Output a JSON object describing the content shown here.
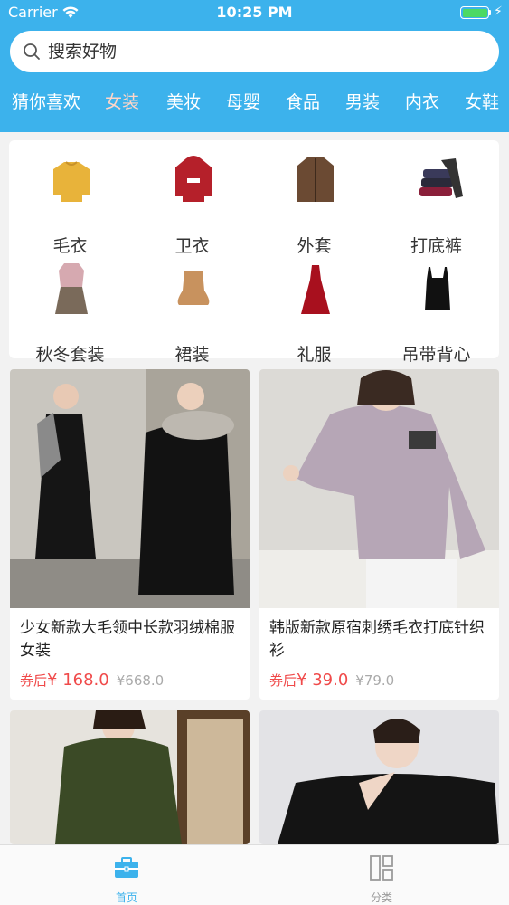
{
  "status": {
    "carrier": "Carrier",
    "time": "10:25 PM"
  },
  "search": {
    "placeholder": "搜索好物"
  },
  "categories": [
    "猜你喜欢",
    "女装",
    "美妆",
    "母婴",
    "食品",
    "男装",
    "内衣",
    "女鞋"
  ],
  "active_category": "女装",
  "subcategories": [
    {
      "label": "毛衣",
      "icon": "sweater-icon"
    },
    {
      "label": "卫衣",
      "icon": "hoodie-icon"
    },
    {
      "label": "外套",
      "icon": "coat-icon"
    },
    {
      "label": "打底裤",
      "icon": "leggings-icon"
    },
    {
      "label": "秋冬套装",
      "icon": "outfit-set-icon"
    },
    {
      "label": "裙装",
      "icon": "skirt-icon"
    },
    {
      "label": "礼服",
      "icon": "gown-icon"
    },
    {
      "label": "吊带背心",
      "icon": "camisole-icon"
    }
  ],
  "products": [
    {
      "title": "少女新款大毛领中长款羽绒棉服女装",
      "coupon_label": "券后",
      "price": "¥ 168.0",
      "original_price": "¥668.0"
    },
    {
      "title": "韩版新款原宿刺绣毛衣打底针织衫",
      "coupon_label": "券后",
      "price": "¥ 39.0",
      "original_price": "¥79.0"
    },
    {
      "title": "",
      "coupon_label": "",
      "price": "",
      "original_price": ""
    },
    {
      "title": "",
      "coupon_label": "",
      "price": "",
      "original_price": ""
    }
  ],
  "tabbar": [
    {
      "label": "首页",
      "icon": "briefcase-icon",
      "active": true
    },
    {
      "label": "分类",
      "icon": "category-grid-icon",
      "active": false
    }
  ],
  "colors": {
    "brand": "#3cb2ec",
    "price": "#f04a4a",
    "tab_inactive": "#9a9a9a"
  }
}
